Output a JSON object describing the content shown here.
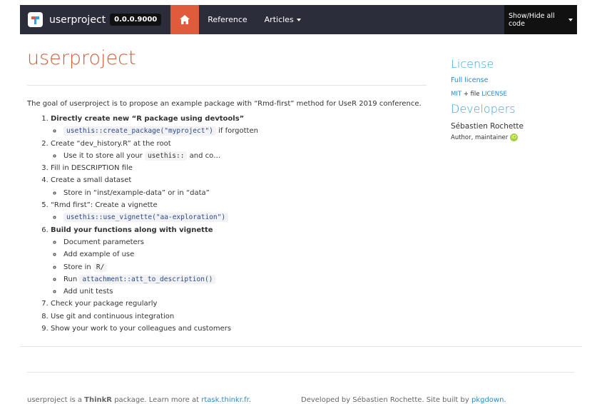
{
  "navbar": {
    "brand": "userproject",
    "version": "0.0.0.9000",
    "home_icon": "home-icon",
    "reference": "Reference",
    "articles": "Articles",
    "code_toggle": "Show/Hide all code"
  },
  "colors": {
    "navbar_bg": "#2b2d3b",
    "home_active": "#e05b3c",
    "title": "#d05f3a",
    "sidebar_heading": "#3aa4d6",
    "link": "#2c8ac9"
  },
  "main": {
    "title": "userproject",
    "intro": "The goal of userproject is to propose an example package with “Rmd-first” method for UseR 2019 conference.",
    "steps": [
      {
        "text": "Directly create new “R package using devtools”",
        "bold": true,
        "sub": [
          {
            "code": "usethis::create_package(\"myproject\")",
            "after": " if forgotten"
          }
        ]
      },
      {
        "text": "Create “dev_history.R” at the root",
        "sub": [
          {
            "before": "Use it to store all your ",
            "code": "usethis::",
            "after": " and co…"
          }
        ]
      },
      {
        "text": "Fill in DESCRIPTION file"
      },
      {
        "text": "Create a small dataset",
        "sub": [
          {
            "before": "Store in “inst/example-data” or in “data”"
          }
        ]
      },
      {
        "text": "“Rmd first”: Create a vignette",
        "sub": [
          {
            "code": "usethis::use_vignette(\"aa-exploration\")"
          }
        ]
      },
      {
        "text": "Build your functions along with vignette",
        "bold": true,
        "sub": [
          {
            "before": "Document parameters"
          },
          {
            "before": "Add example of use"
          },
          {
            "before": "Store in ",
            "code": "R/"
          },
          {
            "before": "Run ",
            "code": "attachment::att_to_description()"
          },
          {
            "before": "Add unit tests"
          }
        ]
      },
      {
        "text": "Check your package regularly"
      },
      {
        "text": "Use git and continuous integration"
      },
      {
        "text": "Show your work to your colleagues and customers"
      }
    ]
  },
  "sidebar": {
    "license_heading": "License",
    "full_license": "Full license",
    "mit": "MIT",
    "plus_file": " + file ",
    "license_file": "LICENSE",
    "developers_heading": "Developers",
    "developer_name": "Sébastien Rochette",
    "developer_role": "Author, maintainer",
    "orcid_label": "iD"
  },
  "footer": {
    "left_prefix": "userproject is a ",
    "left_brand": "ThinkR",
    "left_middle": " package. Learn more at ",
    "left_link": "rtask.thinkr.fr",
    "left_suffix": ".",
    "right_prefix": "Developed by Sébastien Rochette. Site built by ",
    "right_link": "pkgdown",
    "right_suffix": "."
  }
}
